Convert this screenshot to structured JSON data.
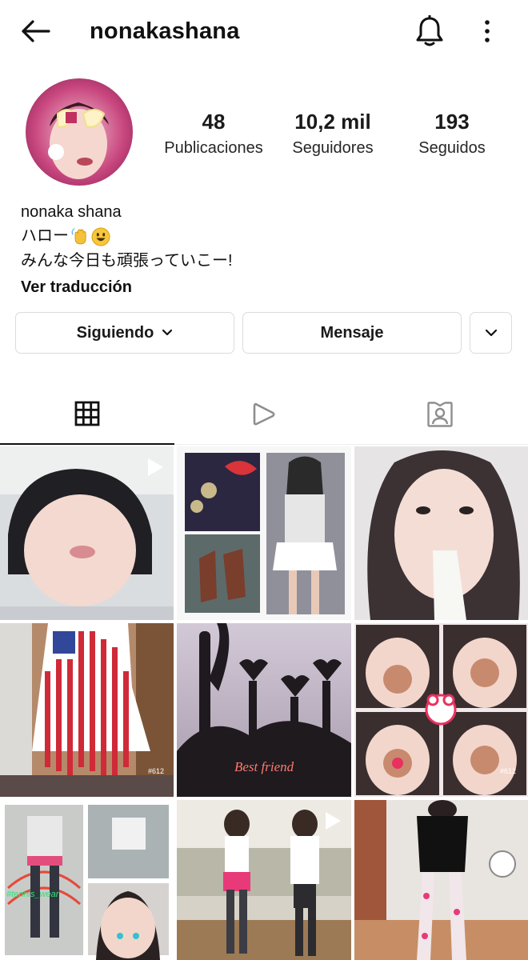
{
  "header": {
    "username": "nonakashana",
    "back_icon": "arrow-left-icon",
    "bell_icon": "bell-icon",
    "more_icon": "more-vertical-icon"
  },
  "profile": {
    "stats": {
      "posts": {
        "value": "48",
        "label": "Publicaciones"
      },
      "followers": {
        "value": "10,2 mil",
        "label": "Seguidores"
      },
      "following": {
        "value": "193",
        "label": "Seguidos"
      }
    },
    "bio": {
      "name": "nonaka  shana",
      "line1": "ハロー",
      "line2": "みんな今日も頑張っていこー!",
      "translate_link": "Ver traducción"
    }
  },
  "actions": {
    "follow_label": "Siguiendo",
    "message_label": "Mensaje"
  },
  "tabs": [
    {
      "name": "grid",
      "icon": "grid-icon",
      "active": true
    },
    {
      "name": "reels",
      "icon": "play-icon",
      "active": false
    },
    {
      "name": "tagged",
      "icon": "tagged-person-icon",
      "active": false
    }
  ],
  "posts": {
    "overlay_texts": [
      "#612",
      "Best friend",
      "#612",
      "#tennis_wear"
    ]
  },
  "colors": {
    "text": "#262626",
    "border": "#dbdbdb",
    "active_tab": "#111111"
  }
}
